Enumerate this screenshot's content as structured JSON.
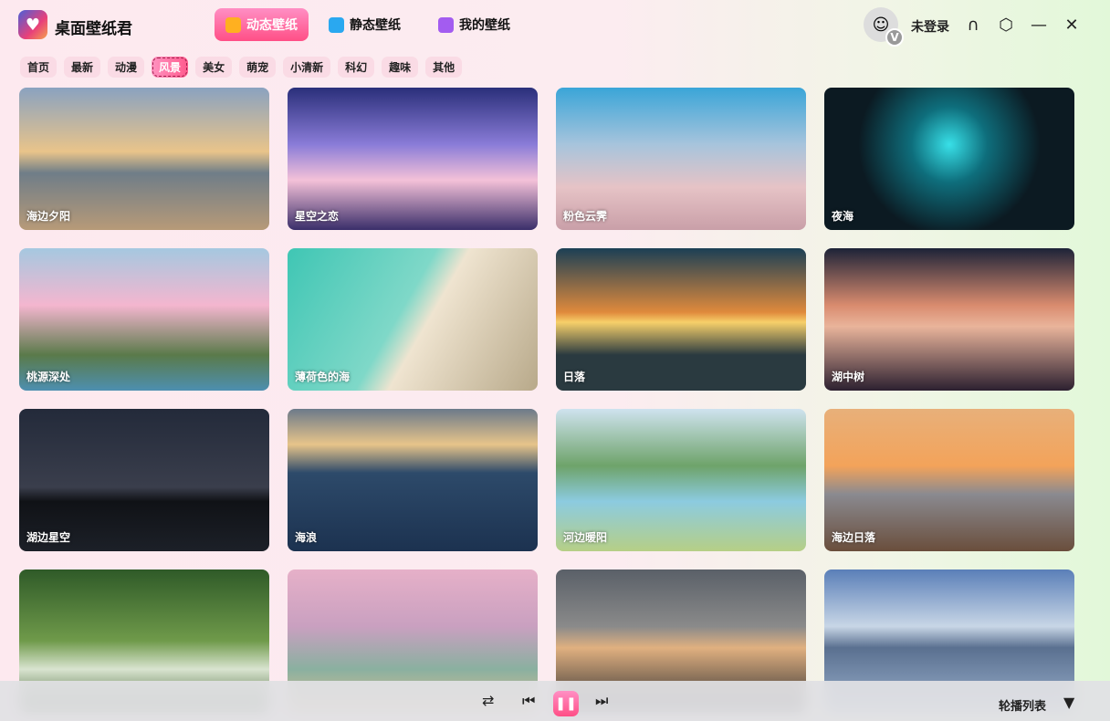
{
  "app": {
    "title": "桌面壁纸君"
  },
  "nav": [
    {
      "label": "动态壁纸",
      "color": "#ffb020"
    },
    {
      "label": "静态壁纸",
      "color": "#2aa8f0"
    },
    {
      "label": "我的壁纸",
      "color": "#a35cf0"
    }
  ],
  "user": {
    "login_label": "未登录",
    "badge": "V"
  },
  "categories": [
    "首页",
    "最新",
    "动漫",
    "风景",
    "美女",
    "萌宠",
    "小清新",
    "科幻",
    "趣味",
    "其他"
  ],
  "active_category": "风景",
  "wallpapers": [
    {
      "title": "海边夕阳",
      "bg": "linear-gradient(180deg,#8aa2c0,#e9c48a 45%,#6f7d88 60%,#b79a78)"
    },
    {
      "title": "星空之恋",
      "bg": "linear-gradient(180deg,#2a2f7a,#8a7cd8 40%,#f4c1d8 65%,#3a2e6a)"
    },
    {
      "title": "粉色云霁",
      "bg": "linear-gradient(180deg,#3aa5d8,#a7c4dc 40%,#e6c3c6 70%,#c99fa8)"
    },
    {
      "title": "夜海",
      "bg": "radial-gradient(circle at 50% 40%,#38e0e8 0%,#0e6e7c 25%,#0c1a22 60%),#0a1216"
    },
    {
      "title": "桃源深处",
      "bg": "linear-gradient(180deg,#a5c8e0,#f4b6cf 40%,#5a7a4a 75%,#4d8fb0)"
    },
    {
      "title": "薄荷色的海",
      "bg": "linear-gradient(120deg,#3fc6b4 0%,#7fd8c8 45%,#efe4d0 55%,#b8a98a 100%)"
    },
    {
      "title": "日落",
      "bg": "linear-gradient(180deg,#1b3f55,#e08a3c 45%,#f7d06a 52%,#2a3a40 75%)"
    },
    {
      "title": "湖中树",
      "bg": "linear-gradient(180deg,#1d2338,#d98b6e 40%,#e9b49b 55%,#2c2030)"
    },
    {
      "title": "湖边星空",
      "bg": "linear-gradient(180deg,#232a3a,#3a3e4c 55%,#101216 65%,#1c2028)"
    },
    {
      "title": "海浪",
      "bg": "linear-gradient(180deg,#6c7a8a,#e7c48a 25%,#2d4a6a 45%,#1c3250)"
    },
    {
      "title": "河边暖阳",
      "bg": "linear-gradient(180deg,#cfe3ef,#6ea36a 40%,#8ccbe0 65%,#b6cf86)"
    },
    {
      "title": "海边日落",
      "bg": "linear-gradient(180deg,#e8b07a,#f3a35a 40%,#8a8a90 60%,#6a4e3c)"
    },
    {
      "title": "",
      "bg": "linear-gradient(180deg,#2f5a28,#6f9a4a 50%,#d9e4d0 70%,#3a5a2a)"
    },
    {
      "title": "",
      "bg": "linear-gradient(180deg,#e6b0c8,#c9a0c0 40%,#8ab0a0 70%,#e0c090)"
    },
    {
      "title": "",
      "bg": "linear-gradient(180deg,#5a6068,#8a8a8a 40%,#e0b080 55%,#2a2c30)"
    },
    {
      "title": "",
      "bg": "linear-gradient(180deg,#5a7fb8,#c8d6e6 40%,#5a7090 55%,#9ab0cc)"
    }
  ],
  "player": {
    "playlist_label": "轮播列表"
  }
}
